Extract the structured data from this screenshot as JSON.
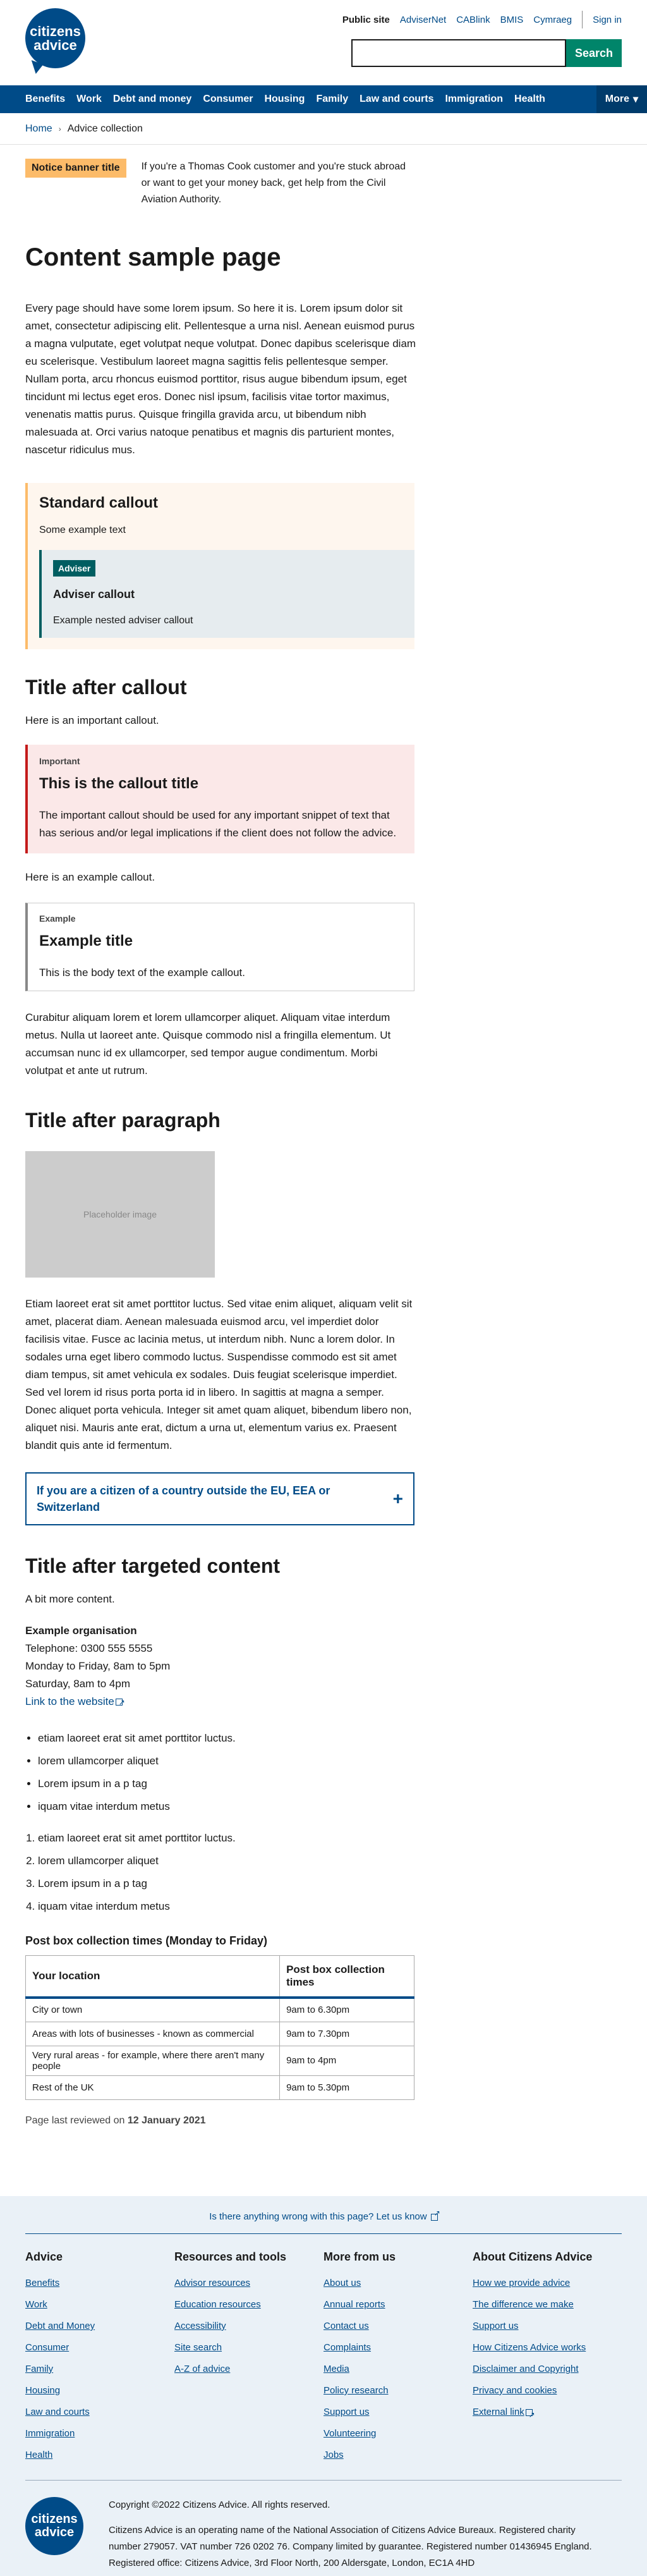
{
  "header": {
    "logo_text": "citizens advice",
    "top_links": {
      "public_site": "Public site",
      "advisernet": "AdviserNet",
      "cablink": "CABlink",
      "bmis": "BMIS",
      "cymraeg": "Cymraeg",
      "sign_in": "Sign in"
    },
    "search": {
      "placeholder": "",
      "button": "Search"
    }
  },
  "nav": {
    "items": [
      "Benefits",
      "Work",
      "Debt and money",
      "Consumer",
      "Housing",
      "Family",
      "Law and courts",
      "Immigration",
      "Health"
    ],
    "more": "More"
  },
  "breadcrumb": {
    "home": "Home",
    "current": "Advice collection"
  },
  "notice": {
    "title": "Notice banner title",
    "text": "If you're a Thomas Cook customer and you're stuck abroad or want to get your money back, get help from the Civil Aviation Authority."
  },
  "page_title": "Content sample page",
  "intro": "Every page should have some lorem ipsum. So here it is. Lorem ipsum dolor sit amet, consectetur adipiscing elit. Pellentesque a urna nisl. Aenean euismod purus a magna vulputate, eget volutpat neque volutpat. Donec dapibus scelerisque diam eu scelerisque. Vestibulum laoreet magna sagittis felis pellentesque semper. Nullam porta, arcu rhoncus euismod porttitor, risus augue bibendum ipsum, eget tincidunt mi lectus eget eros. Donec nisl ipsum, facilisis vitae tortor maximus, venenatis mattis purus. Quisque fringilla gravida arcu, ut bibendum nibh malesuada at. Orci varius natoque penatibus et magnis dis parturient montes, nascetur ridiculus mus.",
  "standard_callout": {
    "title": "Standard callout",
    "text": "Some example text",
    "adviser": {
      "badge": "Adviser",
      "title": "Adviser callout",
      "text": "Example nested adviser callout"
    }
  },
  "section_callout": {
    "title": "Title after callout",
    "intro": "Here is an important callout.",
    "important": {
      "label": "Important",
      "title": "This is the callout title",
      "text": "The important callout should be used for any important snippet of text that has serious and/or legal implications if the client does not follow the advice."
    },
    "example_intro": "Here is an example callout.",
    "example": {
      "label": "Example",
      "title": "Example title",
      "text": "This is the body text of the example callout."
    },
    "after": "Curabitur aliquam lorem et lorem ullamcorper aliquet. Aliquam vitae interdum metus. Nulla ut laoreet ante. Quisque commodo nisl a fringilla elementum. Ut accumsan nunc id ex ullamcorper, sed tempor augue condimentum. Morbi volutpat et ante ut rutrum."
  },
  "section_paragraph": {
    "title": "Title after paragraph",
    "image_placeholder": "Placeholder image",
    "text": "Etiam laoreet erat sit amet porttitor luctus. Sed vitae enim aliquet, aliquam velit sit amet, placerat diam. Aenean malesuada euismod arcu, vel imperdiet dolor facilisis vitae. Fusce ac lacinia metus, ut interdum nibh. Nunc a lorem dolor. In sodales urna eget libero commodo luctus. Suspendisse commodo est sit amet diam tempus, sit amet vehicula ex sodales. Duis feugiat scelerisque imperdiet. Sed vel lorem id risus porta porta id in libero. In sagittis at magna a semper. Donec aliquet porta vehicula. Integer sit amet quam aliquet, bibendum libero non, aliquet nisi. Mauris ante erat, dictum a urna ut, elementum varius ex. Praesent blandit quis ante id fermentum.",
    "collapse_title": "If you are a citizen of a country outside the EU, EEA or Switzerland",
    "collapse_icon": "+"
  },
  "section_targeted": {
    "title": "Title after targeted content",
    "intro": "A bit more content.",
    "org": {
      "name": "Example organisation",
      "telephone": "Telephone: 0300 555 5555",
      "hours1": "Monday to Friday, 8am to 5pm",
      "hours2": "Saturday, 8am to 4pm",
      "link": "Link to the website"
    },
    "bullets": [
      "etiam laoreet erat sit amet porttitor luctus.",
      "lorem ullamcorper aliquet",
      "Lorem ipsum in a p tag",
      "iquam vitae interdum metus"
    ],
    "numbered": [
      "etiam laoreet erat sit amet porttitor luctus.",
      "lorem ullamcorper aliquet",
      "Lorem ipsum in a p tag",
      "iquam vitae interdum metus"
    ]
  },
  "table": {
    "title": "Post box collection times (Monday to Friday)",
    "headers": [
      "Your location",
      "Post box collection times"
    ],
    "rows": [
      [
        "City or town",
        "9am to 6.30pm"
      ],
      [
        "Areas with lots of businesses - known as commercial",
        "9am to 7.30pm"
      ],
      [
        "Very rural areas - for example, where there aren't many people",
        "9am to 4pm"
      ],
      [
        "Rest of the UK",
        "9am to 5.30pm"
      ]
    ]
  },
  "reviewed": {
    "prefix": "Page last reviewed on",
    "date": "12 January 2021"
  },
  "footer": {
    "feedback": "Is there anything wrong with this page? Let us know",
    "columns": [
      {
        "title": "Advice",
        "links": [
          "Benefits",
          "Work",
          "Debt and Money",
          "Consumer",
          "Family",
          "Housing",
          "Law and courts",
          "Immigration",
          "Health"
        ]
      },
      {
        "title": "Resources and tools",
        "links": [
          "Advisor resources",
          "Education resources",
          "Accessibility",
          "Site search",
          "A-Z of advice"
        ]
      },
      {
        "title": "More from us",
        "links": [
          "About us",
          "Annual reports",
          "Contact us",
          "Complaints",
          "Media",
          "Policy research",
          "Support us",
          "Volunteering",
          "Jobs"
        ]
      },
      {
        "title": "About Citizens Advice",
        "links": [
          "How we provide advice",
          "The difference we make",
          "Support us",
          "How Citizens Advice works",
          "Disclaimer and Copyright",
          "Privacy and cookies",
          "External link"
        ]
      }
    ],
    "logo_text": "citizens advice",
    "copyright": "Copyright ©2022 Citizens Advice. All rights reserved.",
    "legal": "Citizens Advice is an operating name of the National Association of Citizens Advice Bureaux. Registered charity number 279057. VAT number 726 0202 76. Company limited by guarantee. Registered number 01436945 England. Registered office: Citizens Advice, 3rd Floor North, 200 Aldersgate, London, EC1A 4HD"
  },
  "colors": {
    "brand_blue": "#004b88",
    "search_green": "#00856a",
    "notice_orange": "#fcbb69",
    "important_red": "#c41a1a",
    "adviser_teal": "#005e61"
  }
}
